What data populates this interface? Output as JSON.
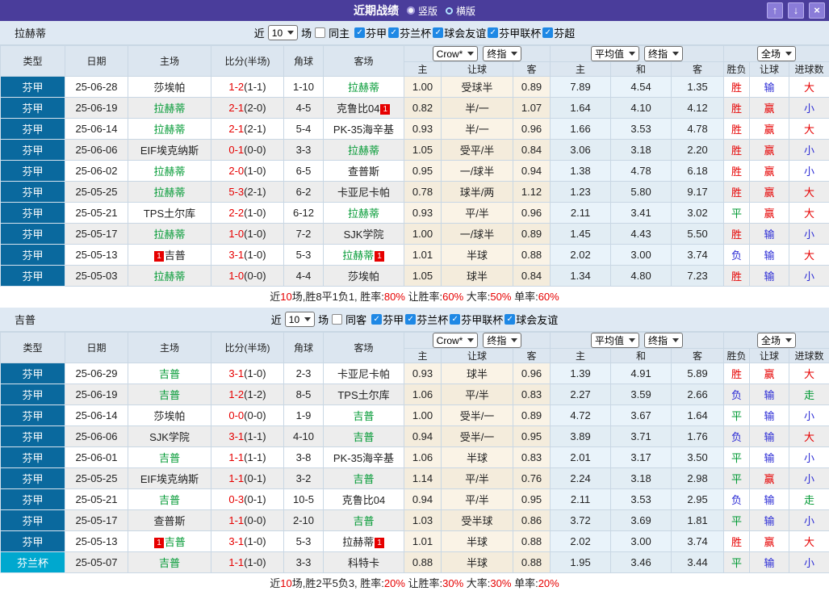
{
  "title_bar": {
    "title": "近期战绩",
    "radios": [
      {
        "label": "竖版",
        "selected": true
      },
      {
        "label": "横版",
        "selected": false
      }
    ],
    "window_buttons": {
      "up": "↑",
      "down": "↓",
      "close": "×"
    }
  },
  "colors": {
    "title_bar": "#4a3d9b",
    "league_type_cell": "#0a699e",
    "cup_type_cell": "#00a8cf",
    "highlight_team": "#009933",
    "red": "#e60000",
    "blue": "#2b2bd5",
    "green": "#009933",
    "checkbox_on": "#1e88e5"
  },
  "result_color_map": {
    "胜": "r",
    "平": "g",
    "负": "b",
    "赢": "r",
    "输": "b",
    "走": "g",
    "大": "r",
    "小": "b"
  },
  "headers": {
    "type": "类型",
    "date": "日期",
    "home": "主场",
    "score": "比分(半场)",
    "corners": "角球",
    "away": "客场",
    "company_select": "Crow*",
    "company_final_select": "终指",
    "avg_select": "平均值",
    "avg_final_select": "终指",
    "scope_select": "全场",
    "h": "主",
    "handicap": "让球",
    "a": "客",
    "h2": "主",
    "draw": "和",
    "a2": "客",
    "result": "胜负",
    "handicap_result": "让球",
    "goals": "进球数"
  },
  "sections": [
    {
      "team": "拉赫蒂",
      "filter": {
        "recent_label": "近",
        "count": "10",
        "matches_label": "场",
        "same_label": "同主",
        "same_checked": false,
        "leagues": [
          {
            "label": "芬甲",
            "checked": true
          },
          {
            "label": "芬兰杯",
            "checked": true
          },
          {
            "label": "球会友谊",
            "checked": true
          },
          {
            "label": "芬甲联杯",
            "checked": true
          },
          {
            "label": "芬超",
            "checked": true
          }
        ]
      },
      "rows": [
        {
          "type": "芬甲",
          "cup": false,
          "date": "25-06-28",
          "home": {
            "text": "莎埃帕",
            "green": false
          },
          "score_full": "1-2",
          "score_half": "(1-1)",
          "corners": "1-10",
          "away": {
            "text": "拉赫蒂",
            "green": true
          },
          "crow": [
            "1.00",
            "受球半",
            "0.89"
          ],
          "avg": [
            "7.89",
            "4.54",
            "1.35"
          ],
          "res": [
            "胜",
            "输",
            "大"
          ]
        },
        {
          "type": "芬甲",
          "cup": false,
          "date": "25-06-19",
          "home": {
            "text": "拉赫蒂",
            "green": true
          },
          "score_full": "2-1",
          "score_half": "(2-0)",
          "corners": "4-5",
          "away": {
            "text": "克鲁比04",
            "green": false,
            "badge": "1",
            "badge_side": "right"
          },
          "crow": [
            "0.82",
            "半/一",
            "1.07"
          ],
          "avg": [
            "1.64",
            "4.10",
            "4.12"
          ],
          "res": [
            "胜",
            "赢",
            "小"
          ]
        },
        {
          "type": "芬甲",
          "cup": false,
          "date": "25-06-14",
          "home": {
            "text": "拉赫蒂",
            "green": true
          },
          "score_full": "2-1",
          "score_half": "(2-1)",
          "corners": "5-4",
          "away": {
            "text": "PK-35海辛基",
            "green": false
          },
          "crow": [
            "0.93",
            "半/一",
            "0.96"
          ],
          "avg": [
            "1.66",
            "3.53",
            "4.78"
          ],
          "res": [
            "胜",
            "赢",
            "大"
          ]
        },
        {
          "type": "芬甲",
          "cup": false,
          "date": "25-06-06",
          "home": {
            "text": "EIF埃克纳斯",
            "green": false
          },
          "score_full": "0-1",
          "score_half": "(0-0)",
          "corners": "3-3",
          "away": {
            "text": "拉赫蒂",
            "green": true
          },
          "crow": [
            "1.05",
            "受平/半",
            "0.84"
          ],
          "avg": [
            "3.06",
            "3.18",
            "2.20"
          ],
          "res": [
            "胜",
            "赢",
            "小"
          ]
        },
        {
          "type": "芬甲",
          "cup": false,
          "date": "25-06-02",
          "home": {
            "text": "拉赫蒂",
            "green": true
          },
          "score_full": "2-0",
          "score_half": "(1-0)",
          "corners": "6-5",
          "away": {
            "text": "查普斯",
            "green": false
          },
          "crow": [
            "0.95",
            "一/球半",
            "0.94"
          ],
          "avg": [
            "1.38",
            "4.78",
            "6.18"
          ],
          "res": [
            "胜",
            "赢",
            "小"
          ]
        },
        {
          "type": "芬甲",
          "cup": false,
          "date": "25-05-25",
          "home": {
            "text": "拉赫蒂",
            "green": true
          },
          "score_full": "5-3",
          "score_half": "(2-1)",
          "corners": "6-2",
          "away": {
            "text": "卡亚尼卡帕",
            "green": false
          },
          "crow": [
            "0.78",
            "球半/两",
            "1.12"
          ],
          "avg": [
            "1.23",
            "5.80",
            "9.17"
          ],
          "res": [
            "胜",
            "赢",
            "大"
          ]
        },
        {
          "type": "芬甲",
          "cup": false,
          "date": "25-05-21",
          "home": {
            "text": "TPS土尔库",
            "green": false
          },
          "score_full": "2-2",
          "score_half": "(1-0)",
          "corners": "6-12",
          "away": {
            "text": "拉赫蒂",
            "green": true
          },
          "crow": [
            "0.93",
            "平/半",
            "0.96"
          ],
          "avg": [
            "2.11",
            "3.41",
            "3.02"
          ],
          "res": [
            "平",
            "赢",
            "大"
          ]
        },
        {
          "type": "芬甲",
          "cup": false,
          "date": "25-05-17",
          "home": {
            "text": "拉赫蒂",
            "green": true
          },
          "score_full": "1-0",
          "score_half": "(1-0)",
          "corners": "7-2",
          "away": {
            "text": "SJK学院",
            "green": false
          },
          "crow": [
            "1.00",
            "一/球半",
            "0.89"
          ],
          "avg": [
            "1.45",
            "4.43",
            "5.50"
          ],
          "res": [
            "胜",
            "输",
            "小"
          ]
        },
        {
          "type": "芬甲",
          "cup": false,
          "date": "25-05-13",
          "home": {
            "text": "吉普",
            "green": false,
            "badge": "1",
            "badge_side": "left"
          },
          "score_full": "3-1",
          "score_half": "(1-0)",
          "corners": "5-3",
          "away": {
            "text": "拉赫蒂",
            "green": true,
            "badge": "1",
            "badge_side": "right"
          },
          "crow": [
            "1.01",
            "半球",
            "0.88"
          ],
          "avg": [
            "2.02",
            "3.00",
            "3.74"
          ],
          "res": [
            "负",
            "输",
            "大"
          ]
        },
        {
          "type": "芬甲",
          "cup": false,
          "date": "25-05-03",
          "home": {
            "text": "拉赫蒂",
            "green": true
          },
          "score_full": "1-0",
          "score_half": "(0-0)",
          "corners": "4-4",
          "away": {
            "text": "莎埃帕",
            "green": false
          },
          "crow": [
            "1.05",
            "球半",
            "0.84"
          ],
          "avg": [
            "1.34",
            "4.80",
            "7.23"
          ],
          "res": [
            "胜",
            "输",
            "小"
          ]
        }
      ],
      "summary": [
        {
          "text": "近",
          "red": false
        },
        {
          "text": "10",
          "red": true
        },
        {
          "text": "场,胜8平1负1, 胜率:",
          "red": false
        },
        {
          "text": "80%",
          "red": true
        },
        {
          "text": " 让胜率:",
          "red": false
        },
        {
          "text": "60%",
          "red": true
        },
        {
          "text": " 大率:",
          "red": false
        },
        {
          "text": "50%",
          "red": true
        },
        {
          "text": " 单率:",
          "red": false
        },
        {
          "text": "60%",
          "red": true
        }
      ]
    },
    {
      "team": "吉普",
      "filter": {
        "recent_label": "近",
        "count": "10",
        "matches_label": "场",
        "same_label": "同客",
        "same_checked": false,
        "leagues": [
          {
            "label": "芬甲",
            "checked": true
          },
          {
            "label": "芬兰杯",
            "checked": true
          },
          {
            "label": "芬甲联杯",
            "checked": true
          },
          {
            "label": "球会友谊",
            "checked": true
          }
        ]
      },
      "rows": [
        {
          "type": "芬甲",
          "cup": false,
          "date": "25-06-29",
          "home": {
            "text": "吉普",
            "green": true
          },
          "score_full": "3-1",
          "score_half": "(1-0)",
          "corners": "2-3",
          "away": {
            "text": "卡亚尼卡帕",
            "green": false
          },
          "crow": [
            "0.93",
            "球半",
            "0.96"
          ],
          "avg": [
            "1.39",
            "4.91",
            "5.89"
          ],
          "res": [
            "胜",
            "赢",
            "大"
          ]
        },
        {
          "type": "芬甲",
          "cup": false,
          "date": "25-06-19",
          "home": {
            "text": "吉普",
            "green": true
          },
          "score_full": "1-2",
          "score_half": "(1-2)",
          "corners": "8-5",
          "away": {
            "text": "TPS土尔库",
            "green": false
          },
          "crow": [
            "1.06",
            "平/半",
            "0.83"
          ],
          "avg": [
            "2.27",
            "3.59",
            "2.66"
          ],
          "res": [
            "负",
            "输",
            "走"
          ]
        },
        {
          "type": "芬甲",
          "cup": false,
          "date": "25-06-14",
          "home": {
            "text": "莎埃帕",
            "green": false
          },
          "score_full": "0-0",
          "score_half": "(0-0)",
          "corners": "1-9",
          "away": {
            "text": "吉普",
            "green": true
          },
          "crow": [
            "1.00",
            "受半/一",
            "0.89"
          ],
          "avg": [
            "4.72",
            "3.67",
            "1.64"
          ],
          "res": [
            "平",
            "输",
            "小"
          ]
        },
        {
          "type": "芬甲",
          "cup": false,
          "date": "25-06-06",
          "home": {
            "text": "SJK学院",
            "green": false
          },
          "score_full": "3-1",
          "score_half": "(1-1)",
          "corners": "4-10",
          "away": {
            "text": "吉普",
            "green": true
          },
          "crow": [
            "0.94",
            "受半/一",
            "0.95"
          ],
          "avg": [
            "3.89",
            "3.71",
            "1.76"
          ],
          "res": [
            "负",
            "输",
            "大"
          ]
        },
        {
          "type": "芬甲",
          "cup": false,
          "date": "25-06-01",
          "home": {
            "text": "吉普",
            "green": true
          },
          "score_full": "1-1",
          "score_half": "(1-1)",
          "corners": "3-8",
          "away": {
            "text": "PK-35海辛基",
            "green": false
          },
          "crow": [
            "1.06",
            "半球",
            "0.83"
          ],
          "avg": [
            "2.01",
            "3.17",
            "3.50"
          ],
          "res": [
            "平",
            "输",
            "小"
          ]
        },
        {
          "type": "芬甲",
          "cup": false,
          "date": "25-05-25",
          "home": {
            "text": "EIF埃克纳斯",
            "green": false
          },
          "score_full": "1-1",
          "score_half": "(0-1)",
          "corners": "3-2",
          "away": {
            "text": "吉普",
            "green": true
          },
          "crow": [
            "1.14",
            "平/半",
            "0.76"
          ],
          "avg": [
            "2.24",
            "3.18",
            "2.98"
          ],
          "res": [
            "平",
            "赢",
            "小"
          ]
        },
        {
          "type": "芬甲",
          "cup": false,
          "date": "25-05-21",
          "home": {
            "text": "吉普",
            "green": true
          },
          "score_full": "0-3",
          "score_half": "(0-1)",
          "corners": "10-5",
          "away": {
            "text": "克鲁比04",
            "green": false
          },
          "crow": [
            "0.94",
            "平/半",
            "0.95"
          ],
          "avg": [
            "2.11",
            "3.53",
            "2.95"
          ],
          "res": [
            "负",
            "输",
            "走"
          ]
        },
        {
          "type": "芬甲",
          "cup": false,
          "date": "25-05-17",
          "home": {
            "text": "查普斯",
            "green": false
          },
          "score_full": "1-1",
          "score_half": "(0-0)",
          "corners": "2-10",
          "away": {
            "text": "吉普",
            "green": true
          },
          "crow": [
            "1.03",
            "受半球",
            "0.86"
          ],
          "avg": [
            "3.72",
            "3.69",
            "1.81"
          ],
          "res": [
            "平",
            "输",
            "小"
          ]
        },
        {
          "type": "芬甲",
          "cup": false,
          "date": "25-05-13",
          "home": {
            "text": "吉普",
            "green": true,
            "badge": "1",
            "badge_side": "left"
          },
          "score_full": "3-1",
          "score_half": "(1-0)",
          "corners": "5-3",
          "away": {
            "text": "拉赫蒂",
            "green": false,
            "badge": "1",
            "badge_side": "right"
          },
          "crow": [
            "1.01",
            "半球",
            "0.88"
          ],
          "avg": [
            "2.02",
            "3.00",
            "3.74"
          ],
          "res": [
            "胜",
            "赢",
            "大"
          ]
        },
        {
          "type": "芬兰杯",
          "cup": true,
          "date": "25-05-07",
          "home": {
            "text": "吉普",
            "green": true
          },
          "score_full": "1-1",
          "score_half": "(1-0)",
          "corners": "3-3",
          "away": {
            "text": "科特卡",
            "green": false
          },
          "crow": [
            "0.88",
            "半球",
            "0.88"
          ],
          "avg": [
            "1.95",
            "3.46",
            "3.44"
          ],
          "res": [
            "平",
            "输",
            "小"
          ]
        }
      ],
      "summary": [
        {
          "text": "近",
          "red": false
        },
        {
          "text": "10",
          "red": true
        },
        {
          "text": "场,胜2平5负3, 胜率:",
          "red": false
        },
        {
          "text": "20%",
          "red": true
        },
        {
          "text": " 让胜率:",
          "red": false
        },
        {
          "text": "30%",
          "red": true
        },
        {
          "text": " 大率:",
          "red": false
        },
        {
          "text": "30%",
          "red": true
        },
        {
          "text": " 单率:",
          "red": false
        },
        {
          "text": "20%",
          "red": true
        }
      ]
    }
  ]
}
